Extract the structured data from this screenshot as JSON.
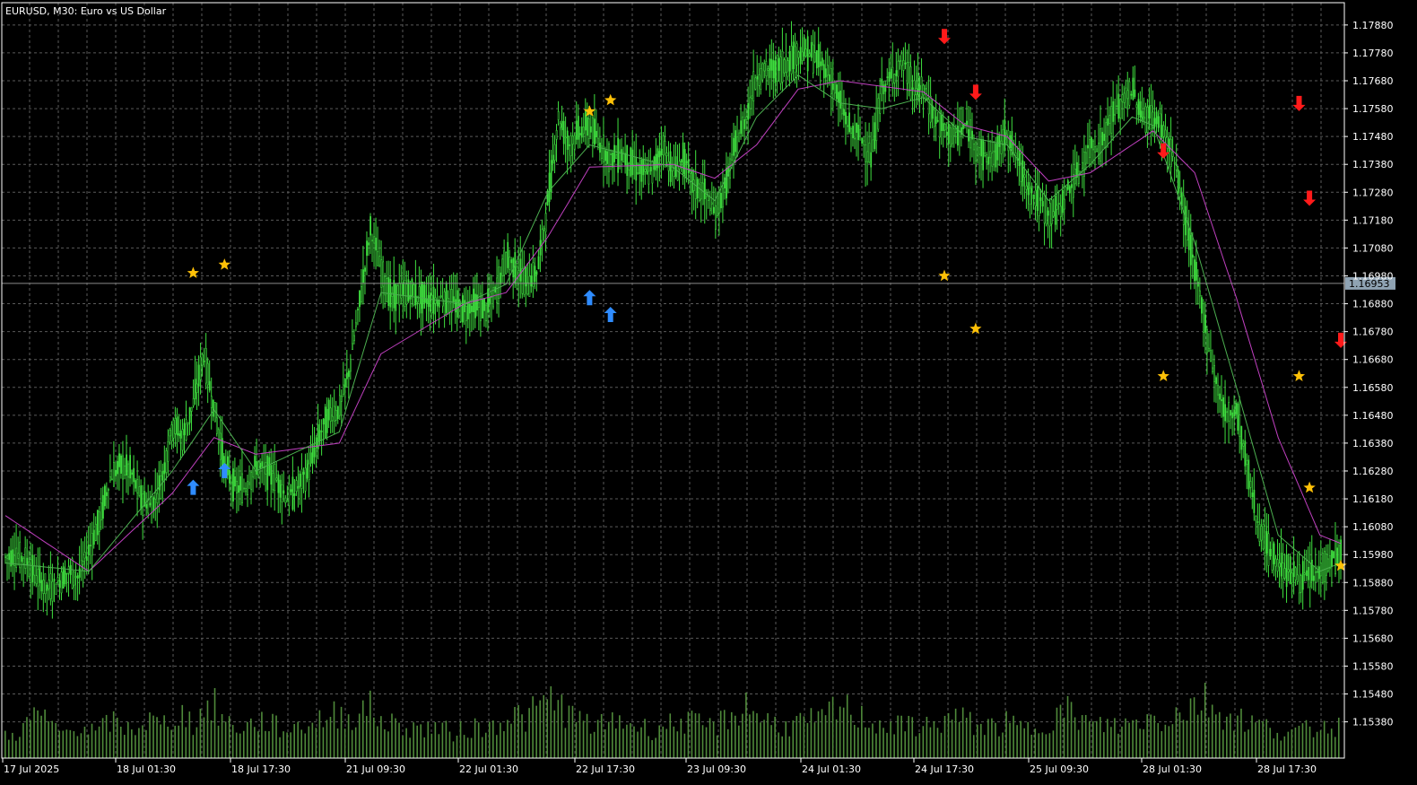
{
  "chart_data": {
    "type": "candlestick",
    "title": "EURUSD, M30:  Euro vs US Dollar",
    "background_color": "#000000",
    "grid": true,
    "grid_style": "dashed",
    "grid_color": "#5a5a5a",
    "candle_color": "#3fdf3f",
    "volume_color": "#4f8a3a",
    "fast_ma_color": "#4caf50",
    "slow_ma_color": "#c040c0",
    "bid_line_color": "#8a8a8a",
    "current_price": "1.16953",
    "ylim": [
      1.1525,
      1.1796
    ],
    "y_ticks": [
      "1.17880",
      "1.17780",
      "1.17680",
      "1.17580",
      "1.17480",
      "1.17380",
      "1.17280",
      "1.17180",
      "1.17080",
      "1.16980",
      "1.16880",
      "1.16780",
      "1.16680",
      "1.16580",
      "1.16480",
      "1.16380",
      "1.16280",
      "1.16180",
      "1.16080",
      "1.15980",
      "1.15880",
      "1.15780",
      "1.15680",
      "1.15580",
      "1.15480",
      "1.15380"
    ],
    "x_labels": [
      "17 Jul 2025",
      "18 Jul 01:30",
      "18 Jul 17:30",
      "21 Jul 09:30",
      "22 Jul 01:30",
      "22 Jul 17:30",
      "23 Jul 09:30",
      "24 Jul 01:30",
      "24 Jul 17:30",
      "25 Jul 09:30",
      "28 Jul 01:30",
      "28 Jul 17:30"
    ],
    "price_path": [
      [
        0,
        1.1597
      ],
      [
        1,
        1.1598
      ],
      [
        2,
        1.1596
      ],
      [
        3,
        1.159
      ],
      [
        4,
        1.1586
      ],
      [
        5,
        1.1588
      ],
      [
        6,
        1.1592
      ],
      [
        7,
        1.159
      ],
      [
        8,
        1.16
      ],
      [
        9,
        1.161
      ],
      [
        10,
        1.1625
      ],
      [
        11,
        1.163
      ],
      [
        12,
        1.1628
      ],
      [
        13,
        1.1618
      ],
      [
        14,
        1.1615
      ],
      [
        15,
        1.1625
      ],
      [
        16,
        1.1645
      ],
      [
        17,
        1.164
      ],
      [
        18,
        1.1652
      ],
      [
        19,
        1.167
      ],
      [
        20,
        1.165
      ],
      [
        21,
        1.163
      ],
      [
        22,
        1.1622
      ],
      [
        23,
        1.1622
      ],
      [
        24,
        1.163
      ],
      [
        25,
        1.1628
      ],
      [
        26,
        1.1625
      ],
      [
        27,
        1.1618
      ],
      [
        28,
        1.1622
      ],
      [
        29,
        1.1628
      ],
      [
        30,
        1.164
      ],
      [
        31,
        1.1648
      ],
      [
        32,
        1.165
      ],
      [
        33,
        1.1665
      ],
      [
        34,
        1.169
      ],
      [
        35,
        1.1715
      ],
      [
        36,
        1.17
      ],
      [
        37,
        1.169
      ],
      [
        38,
        1.1692
      ],
      [
        39,
        1.1692
      ],
      [
        40,
        1.169
      ],
      [
        41,
        1.1689
      ],
      [
        42,
        1.169
      ],
      [
        43,
        1.1688
      ],
      [
        44,
        1.1686
      ],
      [
        45,
        1.1688
      ],
      [
        46,
        1.1686
      ],
      [
        47,
        1.1692
      ],
      [
        48,
        1.1705
      ],
      [
        49,
        1.17
      ],
      [
        50,
        1.1695
      ],
      [
        51,
        1.17
      ],
      [
        52,
        1.1725
      ],
      [
        53,
        1.1755
      ],
      [
        54,
        1.1745
      ],
      [
        55,
        1.175
      ],
      [
        56,
        1.1752
      ],
      [
        57,
        1.1745
      ],
      [
        58,
        1.174
      ],
      [
        59,
        1.1742
      ],
      [
        60,
        1.1738
      ],
      [
        61,
        1.1735
      ],
      [
        62,
        1.1735
      ],
      [
        63,
        1.1745
      ],
      [
        64,
        1.1735
      ],
      [
        65,
        1.174
      ],
      [
        66,
        1.173
      ],
      [
        67,
        1.1728
      ],
      [
        68,
        1.172
      ],
      [
        69,
        1.173
      ],
      [
        70,
        1.1745
      ],
      [
        71,
        1.1755
      ],
      [
        72,
        1.177
      ],
      [
        73,
        1.1772
      ],
      [
        74,
        1.1772
      ],
      [
        75,
        1.1775
      ],
      [
        76,
        1.1778
      ],
      [
        77,
        1.1778
      ],
      [
        78,
        1.1775
      ],
      [
        79,
        1.177
      ],
      [
        80,
        1.176
      ],
      [
        81,
        1.175
      ],
      [
        82,
        1.1748
      ],
      [
        83,
        1.174
      ],
      [
        84,
        1.1765
      ],
      [
        85,
        1.177
      ],
      [
        86,
        1.1775
      ],
      [
        87,
        1.1765
      ],
      [
        88,
        1.1765
      ],
      [
        89,
        1.1755
      ],
      [
        90,
        1.175
      ],
      [
        91,
        1.1748
      ],
      [
        92,
        1.1752
      ],
      [
        93,
        1.1745
      ],
      [
        94,
        1.174
      ],
      [
        95,
        1.1742
      ],
      [
        96,
        1.175
      ],
      [
        97,
        1.174
      ],
      [
        98,
        1.173
      ],
      [
        99,
        1.1725
      ],
      [
        100,
        1.172
      ],
      [
        101,
        1.1722
      ],
      [
        102,
        1.173
      ],
      [
        103,
        1.1735
      ],
      [
        104,
        1.1745
      ],
      [
        105,
        1.1745
      ],
      [
        106,
        1.1755
      ],
      [
        107,
        1.176
      ],
      [
        108,
        1.1765
      ],
      [
        109,
        1.1755
      ],
      [
        110,
        1.1755
      ],
      [
        111,
        1.175
      ],
      [
        112,
        1.174
      ],
      [
        113,
        1.172
      ],
      [
        114,
        1.17
      ],
      [
        115,
        1.168
      ],
      [
        116,
        1.166
      ],
      [
        117,
        1.1648
      ],
      [
        118,
        1.165
      ],
      [
        119,
        1.163
      ],
      [
        120,
        1.161
      ],
      [
        121,
        1.16
      ],
      [
        122,
        1.1595
      ],
      [
        123,
        1.1592
      ],
      [
        124,
        1.159
      ],
      [
        125,
        1.159
      ],
      [
        126,
        1.1592
      ],
      [
        127,
        1.1596
      ],
      [
        128,
        1.1598
      ]
    ],
    "fast_ma": [
      [
        0,
        1.1595
      ],
      [
        8,
        1.1592
      ],
      [
        16,
        1.1628
      ],
      [
        20,
        1.165
      ],
      [
        24,
        1.1628
      ],
      [
        32,
        1.1642
      ],
      [
        36,
        1.1692
      ],
      [
        44,
        1.1688
      ],
      [
        48,
        1.1695
      ],
      [
        52,
        1.1728
      ],
      [
        56,
        1.1745
      ],
      [
        64,
        1.1737
      ],
      [
        68,
        1.1725
      ],
      [
        72,
        1.1755
      ],
      [
        76,
        1.177
      ],
      [
        80,
        1.176
      ],
      [
        84,
        1.1758
      ],
      [
        88,
        1.1762
      ],
      [
        92,
        1.1748
      ],
      [
        96,
        1.1745
      ],
      [
        100,
        1.1725
      ],
      [
        104,
        1.1738
      ],
      [
        108,
        1.1755
      ],
      [
        110,
        1.1752
      ],
      [
        114,
        1.171
      ],
      [
        118,
        1.1658
      ],
      [
        122,
        1.1605
      ],
      [
        126,
        1.1592
      ],
      [
        128,
        1.1595
      ]
    ],
    "slow_ma": [
      [
        0,
        1.1612
      ],
      [
        8,
        1.1592
      ],
      [
        16,
        1.162
      ],
      [
        20,
        1.164
      ],
      [
        24,
        1.1634
      ],
      [
        32,
        1.1638
      ],
      [
        36,
        1.167
      ],
      [
        44,
        1.1688
      ],
      [
        48,
        1.1692
      ],
      [
        52,
        1.1712
      ],
      [
        56,
        1.1737
      ],
      [
        64,
        1.1738
      ],
      [
        68,
        1.1733
      ],
      [
        72,
        1.1745
      ],
      [
        76,
        1.1765
      ],
      [
        80,
        1.1768
      ],
      [
        84,
        1.1766
      ],
      [
        88,
        1.1764
      ],
      [
        92,
        1.1752
      ],
      [
        96,
        1.1748
      ],
      [
        100,
        1.1732
      ],
      [
        104,
        1.1735
      ],
      [
        108,
        1.1745
      ],
      [
        110,
        1.175
      ],
      [
        114,
        1.1735
      ],
      [
        118,
        1.169
      ],
      [
        122,
        1.164
      ],
      [
        126,
        1.1605
      ],
      [
        128,
        1.1602
      ]
    ],
    "buy_arrows": [
      [
        18,
        1.1622
      ],
      [
        21,
        1.1628
      ],
      [
        56,
        1.169
      ],
      [
        58,
        1.1684
      ]
    ],
    "sell_arrows": [
      [
        90,
        1.1784
      ],
      [
        93,
        1.1764
      ],
      [
        111,
        1.1743
      ],
      [
        124,
        1.176
      ],
      [
        125,
        1.1726
      ],
      [
        128,
        1.1675
      ]
    ],
    "stars": [
      [
        18,
        1.1699
      ],
      [
        21,
        1.1702
      ],
      [
        56,
        1.1757
      ],
      [
        58,
        1.1761
      ],
      [
        90,
        1.1698
      ],
      [
        93,
        1.1679
      ],
      [
        111,
        1.1662
      ],
      [
        124,
        1.1662
      ],
      [
        125,
        1.1622
      ],
      [
        128,
        1.1594
      ]
    ],
    "volume": {
      "max_label": "",
      "series": [
        0.35,
        0.4,
        0.5,
        0.75,
        0.55,
        0.45,
        0.4,
        0.55,
        0.45,
        0.4,
        0.6,
        0.5,
        0.45,
        0.55,
        0.6,
        0.5,
        0.65,
        0.7,
        0.55,
        0.75,
        0.85,
        0.6,
        0.5,
        0.5,
        0.55,
        0.6,
        0.5,
        0.45,
        0.5,
        0.55,
        0.6,
        0.65,
        0.7,
        0.65,
        0.75,
        0.8,
        0.6,
        0.55,
        0.5,
        0.5,
        0.45,
        0.5,
        0.45,
        0.4,
        0.45,
        0.5,
        0.45,
        0.55,
        0.65,
        0.7,
        0.6,
        0.8,
        0.9,
        0.95,
        0.7,
        0.6,
        0.55,
        0.5,
        0.55,
        0.6,
        0.55,
        0.5,
        0.45,
        0.5,
        0.55,
        0.6,
        0.55,
        0.5,
        0.5,
        0.6,
        0.7,
        0.85,
        0.75,
        0.6,
        0.55,
        0.5,
        0.55,
        0.6,
        0.55,
        0.7,
        0.8,
        0.75,
        0.65,
        0.6,
        0.55,
        0.5,
        0.5,
        0.55,
        0.5,
        0.5,
        0.6,
        0.65,
        0.6,
        0.55,
        0.5,
        0.5,
        0.55,
        0.5,
        0.45,
        0.5,
        0.6,
        0.7,
        0.75,
        0.65,
        0.55,
        0.5,
        0.55,
        0.5,
        0.55,
        0.6,
        0.65,
        0.6,
        0.7,
        0.75,
        0.85,
        0.95,
        0.8,
        0.7,
        0.65,
        0.6,
        0.55,
        0.5,
        0.45,
        0.4,
        0.4,
        0.45,
        0.5,
        0.55,
        0.5
      ]
    }
  }
}
